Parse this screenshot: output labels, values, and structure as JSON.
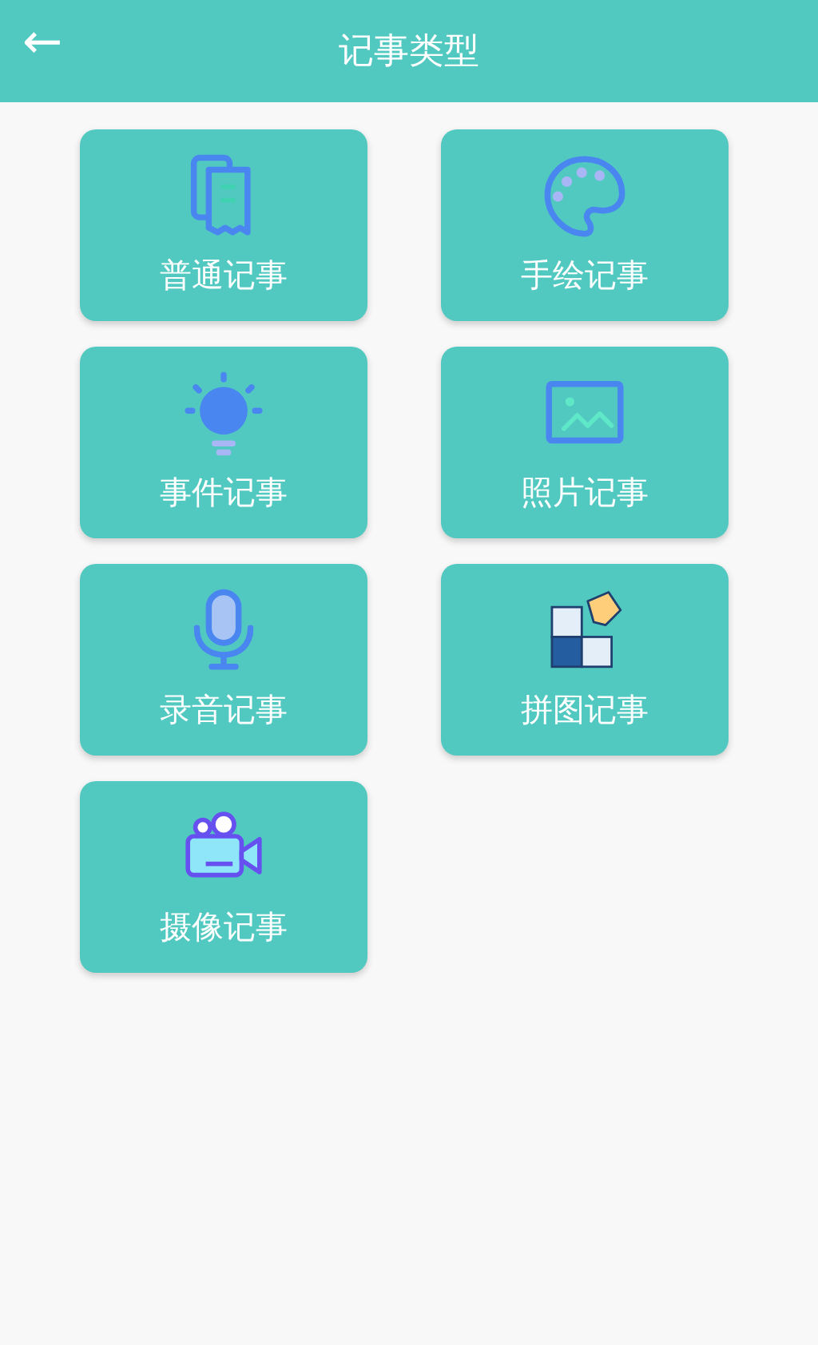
{
  "header": {
    "back": "←",
    "title": "记事类型"
  },
  "note_types": [
    {
      "kind": "documents",
      "label": "普通记事"
    },
    {
      "kind": "palette",
      "label": "手绘记事"
    },
    {
      "kind": "bulb",
      "label": "事件记事"
    },
    {
      "kind": "photo",
      "label": "照片记事"
    },
    {
      "kind": "microphone",
      "label": "录音记事"
    },
    {
      "kind": "puzzle",
      "label": "拼图记事"
    },
    {
      "kind": "camera",
      "label": "摄像记事"
    }
  ]
}
